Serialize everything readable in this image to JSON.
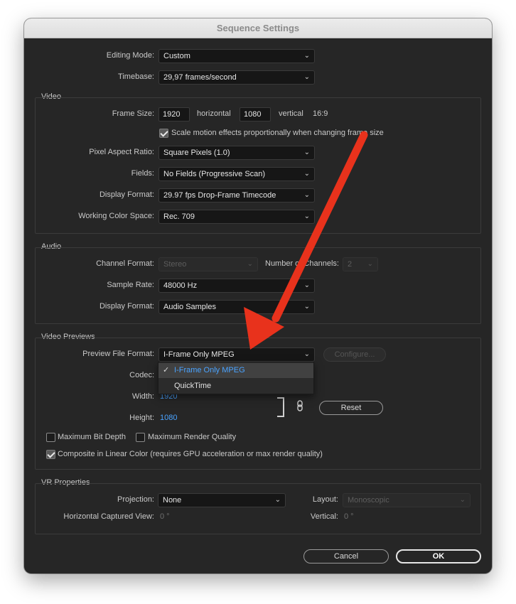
{
  "window": {
    "title": "Sequence Settings"
  },
  "general": {
    "editing_mode_label": "Editing Mode:",
    "editing_mode_value": "Custom",
    "timebase_label": "Timebase:",
    "timebase_value": "29,97  frames/second"
  },
  "video": {
    "group_title": "Video",
    "frame_size_label": "Frame Size:",
    "frame_width": "1920",
    "horizontal_label": "horizontal",
    "frame_height": "1080",
    "vertical_label": "vertical",
    "aspect_ratio": "16:9",
    "scale_motion_label": "Scale motion effects proportionally when changing frame size",
    "scale_motion_checked": true,
    "pixel_aspect_label": "Pixel Aspect Ratio:",
    "pixel_aspect_value": "Square Pixels (1.0)",
    "fields_label": "Fields:",
    "fields_value": "No Fields (Progressive Scan)",
    "display_format_label": "Display Format:",
    "display_format_value": "29.97 fps Drop-Frame Timecode",
    "working_color_label": "Working Color Space:",
    "working_color_value": "Rec. 709"
  },
  "audio": {
    "group_title": "Audio",
    "channel_format_label": "Channel Format:",
    "channel_format_value": "Stereo",
    "num_channels_label": "Number of Channels:",
    "num_channels_value": "2",
    "sample_rate_label": "Sample Rate:",
    "sample_rate_value": "48000 Hz",
    "display_format_label": "Display Format:",
    "display_format_value": "Audio Samples"
  },
  "previews": {
    "group_title": "Video Previews",
    "preview_format_label": "Preview File Format:",
    "preview_format_value": "I-Frame Only MPEG",
    "configure_label": "Configure...",
    "codec_label": "Codec:",
    "width_label": "Width:",
    "width_value": "1920",
    "height_label": "Height:",
    "height_value": "1080",
    "reset_label": "Reset",
    "max_bit_depth_label": "Maximum Bit Depth",
    "max_bit_depth_checked": false,
    "max_render_quality_label": "Maximum Render Quality",
    "max_render_quality_checked": false,
    "composite_linear_label": "Composite in Linear Color (requires GPU acceleration or max render quality)",
    "composite_linear_checked": true,
    "dropdown_options": [
      {
        "label": "I-Frame Only MPEG",
        "selected": true
      },
      {
        "label": "QuickTime",
        "selected": false
      }
    ]
  },
  "vr": {
    "group_title": "VR Properties",
    "projection_label": "Projection:",
    "projection_value": "None",
    "layout_label": "Layout:",
    "layout_value": "Monoscopic",
    "h_captured_label": "Horizontal Captured View:",
    "h_captured_value": "0 °",
    "vertical_label": "Vertical:",
    "vertical_value": "0 °"
  },
  "footer": {
    "cancel_label": "Cancel",
    "ok_label": "OK"
  },
  "colors": {
    "background": "#262626",
    "accent_blue": "#4aa3ff",
    "annotation_arrow": "#e8321c"
  },
  "icons": {
    "chevron": "⌄",
    "check": "✓",
    "link": "chain-link-icon"
  }
}
